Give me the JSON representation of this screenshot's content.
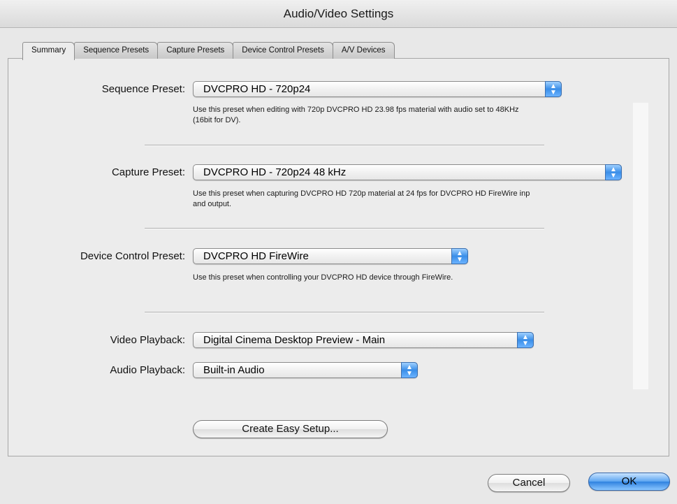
{
  "window": {
    "title": "Audio/Video Settings"
  },
  "tabs": [
    {
      "label": "Summary",
      "active": true
    },
    {
      "label": "Sequence Presets",
      "active": false
    },
    {
      "label": "Capture Presets",
      "active": false
    },
    {
      "label": "Device Control Presets",
      "active": false
    },
    {
      "label": "A/V Devices",
      "active": false
    }
  ],
  "sequence_preset": {
    "label": "Sequence Preset:",
    "value": "DVCPRO HD - 720p24",
    "description_line1": "Use this preset when editing with 720p DVCPRO HD 23.98 fps material with audio set to 48KHz",
    "description_line2": "(16bit for DV)."
  },
  "capture_preset": {
    "label": "Capture Preset:",
    "value": "DVCPRO HD - 720p24 48 kHz",
    "description_line1": "Use this preset when capturing DVCPRO HD 720p material at 24 fps for DVCPRO HD FireWire inp",
    "description_line2": "and output."
  },
  "device_control_preset": {
    "label": "Device Control Preset:",
    "value": "DVCPRO HD FireWire",
    "description_line1": "Use this preset when controlling your DVCPRO HD device through FireWire."
  },
  "video_playback": {
    "label": "Video Playback:",
    "value": "Digital Cinema Desktop Preview - Main"
  },
  "audio_playback": {
    "label": "Audio Playback:",
    "value": "Built-in Audio"
  },
  "buttons": {
    "create_easy_setup": "Create Easy Setup...",
    "cancel": "Cancel",
    "ok": "OK"
  },
  "icons": {
    "popup_arrows": "updown-arrows-icon"
  },
  "colors": {
    "accent": "#3a8ee8",
    "window_bg": "#e8e8e8"
  }
}
